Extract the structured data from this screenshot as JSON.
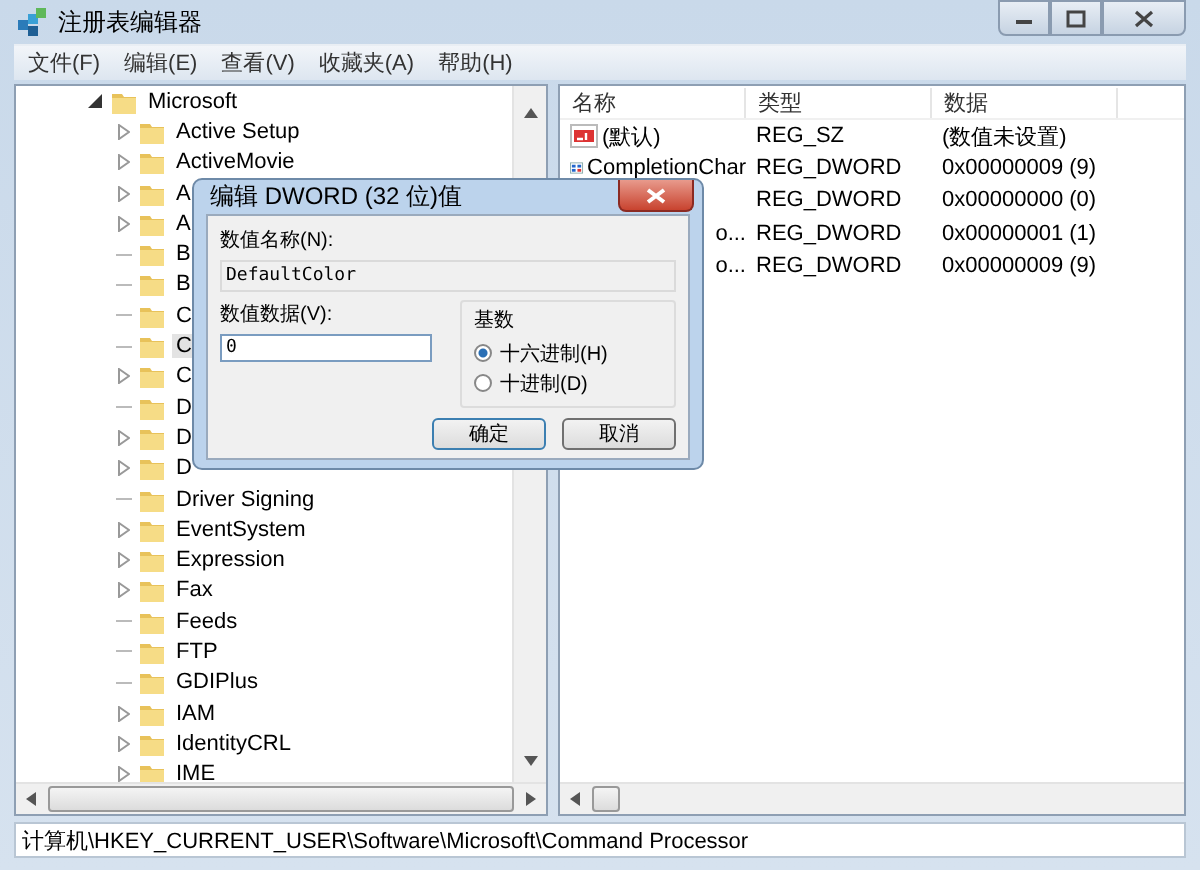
{
  "window": {
    "title": "注册表编辑器"
  },
  "menu": [
    "文件(F)",
    "编辑(E)",
    "查看(V)",
    "收藏夹(A)",
    "帮助(H)"
  ],
  "tree": {
    "label": "Microsoft",
    "expanded": true,
    "children": [
      {
        "label": "Active Setup",
        "expandable": true,
        "selected": false
      },
      {
        "label": "ActiveMovie",
        "expandable": true,
        "selected": false
      },
      {
        "label": "A",
        "expandable": true,
        "selected": false
      },
      {
        "label": "A",
        "expandable": true,
        "selected": false
      },
      {
        "label": "B",
        "expandable": false,
        "selected": false
      },
      {
        "label": "B",
        "expandable": false,
        "selected": false
      },
      {
        "label": "C",
        "expandable": false,
        "selected": false
      },
      {
        "label": "C",
        "expandable": false,
        "selected": true
      },
      {
        "label": "C",
        "expandable": true,
        "selected": false
      },
      {
        "label": "D",
        "expandable": false,
        "selected": false
      },
      {
        "label": "D",
        "expandable": true,
        "selected": false
      },
      {
        "label": "D",
        "expandable": true,
        "selected": false
      },
      {
        "label": "Driver Signing",
        "expandable": false,
        "selected": false
      },
      {
        "label": "EventSystem",
        "expandable": true,
        "selected": false
      },
      {
        "label": "Expression",
        "expandable": true,
        "selected": false
      },
      {
        "label": "Fax",
        "expandable": true,
        "selected": false
      },
      {
        "label": "Feeds",
        "expandable": false,
        "selected": false
      },
      {
        "label": "FTP",
        "expandable": false,
        "selected": false
      },
      {
        "label": "GDIPlus",
        "expandable": false,
        "selected": false
      },
      {
        "label": "IAM",
        "expandable": true,
        "selected": false
      },
      {
        "label": "IdentityCRL",
        "expandable": true,
        "selected": false
      },
      {
        "label": "IME",
        "expandable": true,
        "selected": false
      }
    ]
  },
  "values_table": {
    "columns": [
      "名称",
      "类型",
      "数据"
    ],
    "rows": [
      {
        "kind": "string",
        "name": "(默认)",
        "type": "REG_SZ",
        "data": "(数值未设置)"
      },
      {
        "kind": "dword",
        "name": "CompletionChar",
        "type": "REG_DWORD",
        "data": "0x00000009 (9)"
      },
      {
        "type": "REG_DWORD",
        "data": "0x00000000 (0)"
      },
      {
        "name": "o...",
        "cut": true,
        "type": "REG_DWORD",
        "data": "0x00000001 (1)"
      },
      {
        "name": "o...",
        "cut": true,
        "type": "REG_DWORD",
        "data": "0x00000009 (9)"
      }
    ]
  },
  "dialog": {
    "title": "编辑 DWORD (32 位)值",
    "name_label": "数值名称(N):",
    "name_value": "DefaultColor",
    "data_label": "数值数据(V):",
    "data_value": "0",
    "base_label": "基数",
    "radios": [
      {
        "label": "十六进制(H)",
        "selected": true
      },
      {
        "label": "十进制(D)",
        "selected": false
      }
    ],
    "buttons": [
      "确定",
      "取消"
    ]
  },
  "status_bar": "计算机\\HKEY_CURRENT_USER\\Software\\Microsoft\\Command Processor"
}
